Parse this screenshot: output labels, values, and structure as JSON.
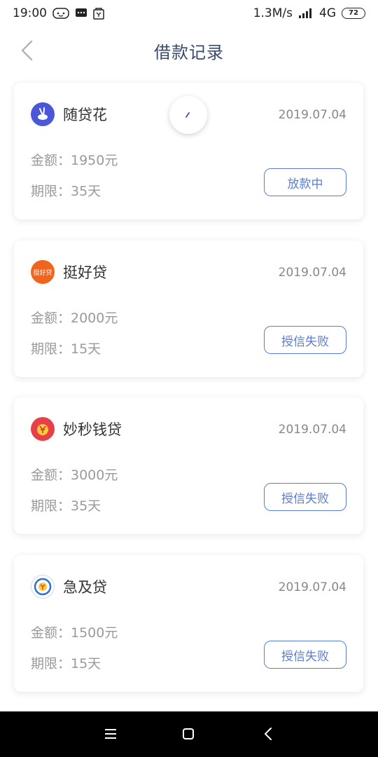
{
  "status_bar": {
    "time": "19:00",
    "network_speed": "1.3M/s",
    "network_type": "4G",
    "battery": "72"
  },
  "header": {
    "title": "借款记录"
  },
  "records": [
    {
      "name": "随贷花",
      "date": "2019.07.04",
      "amount": "金额：1950元",
      "term": "期限：35天",
      "status": "放款中",
      "logo_color": "#4a57d8"
    },
    {
      "name": "挺好贷",
      "date": "2019.07.04",
      "amount": "金额：2000元",
      "term": "期限：15天",
      "status": "授信失败",
      "logo_color": "#f0641e",
      "logo_text": "挺好贷"
    },
    {
      "name": "妙秒钱贷",
      "date": "2019.07.04",
      "amount": "金额：3000元",
      "term": "期限：35天",
      "status": "授信失败",
      "logo_color": "#e8404a"
    },
    {
      "name": "急及贷",
      "date": "2019.07.04",
      "amount": "金额：1500元",
      "term": "期限：15天",
      "status": "授信失败",
      "logo_color": "#2e6fd8"
    }
  ],
  "accent_color": "#5b7bd5"
}
